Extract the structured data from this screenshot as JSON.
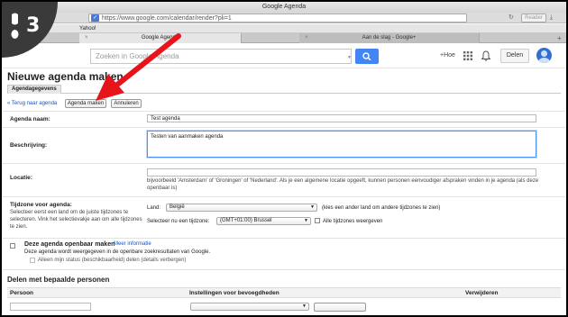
{
  "badge": {
    "step": "3"
  },
  "browser": {
    "window_title": "Google Agenda",
    "url_scheme": "https",
    "url": "www.google.com/calendar/render?pli=1",
    "reader_label": "Reader",
    "bookmark": "Yahoo!",
    "tabs": [
      {
        "label": "Google Agenda"
      },
      {
        "label": "Aan de slag - Google+"
      }
    ]
  },
  "header": {
    "search_placeholder": "Zoeken in Google Agenda",
    "plus_label": "+Hoe",
    "share_label": "Delen"
  },
  "page": {
    "title": "Nieuwe agenda maken",
    "tab_label": "Agendagegevens",
    "back_link": "« Terug naar agenda",
    "create_button": "Agenda maken",
    "cancel_button": "Annuleren"
  },
  "form": {
    "name_label": "Agenda naam:",
    "name_value": "Test agenda",
    "description_label": "Beschrijving:",
    "description_value": "Testen van aanmaken agenda",
    "location_label": "Locatie:",
    "location_hint": "bijvoorbeeld 'Amsterdam' of 'Groningen' of 'Nederland'. Als je een algemene locatie opgeeft, kunnen personen eenvoudiger afspraken vinden in je agenda (als deze openbaar is)",
    "timezone_label": "Tijdzone voor agenda:",
    "timezone_help": "Selecteer eerst een land om de juiste tijdzones te selecteren. Vink het selectievakje aan om alle tijdzones te zien.",
    "country_label": "Land:",
    "country_value": "België",
    "country_hint": "(kies een ander land om andere tijdzones te zien)",
    "tz_select_label": "Selecteer nu een tijdzone:",
    "tz_value": "(GMT+01:00) Brussel",
    "all_tz_label": "Alle tijdzones weergeven",
    "public_title": "Deze agenda openbaar maken",
    "public_more": "Meer informatie",
    "public_desc": "Deze agenda wordt weergegeven in de openbare zoekresultaten van Google.",
    "busy_only": "Alleen mijn status (beschikbaarheid) delen (details verbergen)"
  },
  "sharing": {
    "title": "Delen met bepaalde personen",
    "columns": [
      "Persoon",
      "Instellingen voor bevoegdheden",
      "Verwijderen"
    ]
  }
}
